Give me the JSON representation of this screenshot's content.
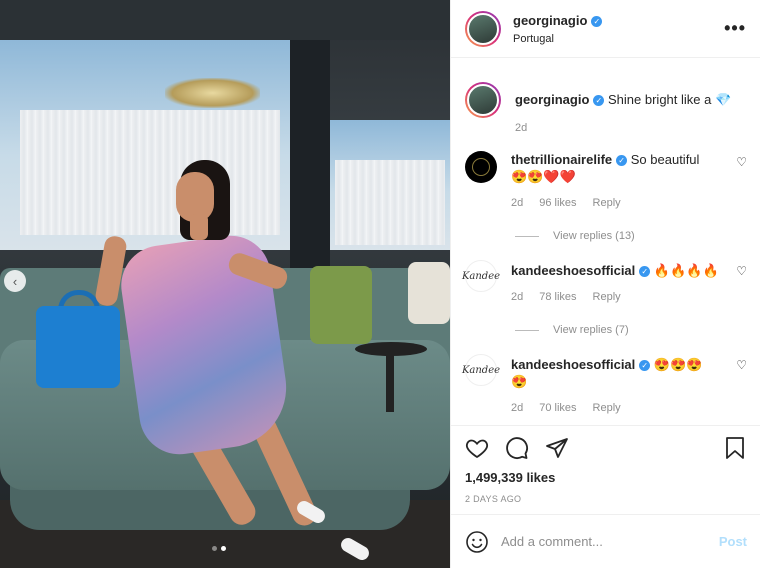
{
  "post": {
    "author": "georginagio",
    "location": "Portugal",
    "carousel": {
      "total": 2,
      "active": 2
    }
  },
  "caption": {
    "author": "georginagio",
    "text": "Shine bright like a 💎",
    "time": "2d"
  },
  "comments": [
    {
      "author": "thetrillionairelife",
      "text": "So beautiful",
      "emojis": "😍😍❤️❤️",
      "time": "2d",
      "likes": "96 likes",
      "reply": "Reply",
      "view_replies": "View replies (13)"
    },
    {
      "author": "kandeeshoesofficial",
      "text": "🔥🔥🔥🔥",
      "time": "2d",
      "likes": "78 likes",
      "reply": "Reply",
      "view_replies": "View replies (7)"
    },
    {
      "author": "kandeeshoesofficial",
      "text": "😍😍😍",
      "text2": "😍",
      "time": "2d",
      "likes": "70 likes",
      "reply": "Reply"
    }
  ],
  "engagement": {
    "likes": "1,499,339 likes",
    "date": "2 DAYS AGO"
  },
  "add_comment": {
    "placeholder": "Add a comment...",
    "post_label": "Post"
  },
  "icons": {
    "verified": "✓",
    "more": "•••",
    "prev": "‹",
    "emoji": "emoji-icon"
  },
  "colors": {
    "verified": "#3897f0",
    "post_disabled": "#b2dffc",
    "muted": "#8e8e8e"
  }
}
